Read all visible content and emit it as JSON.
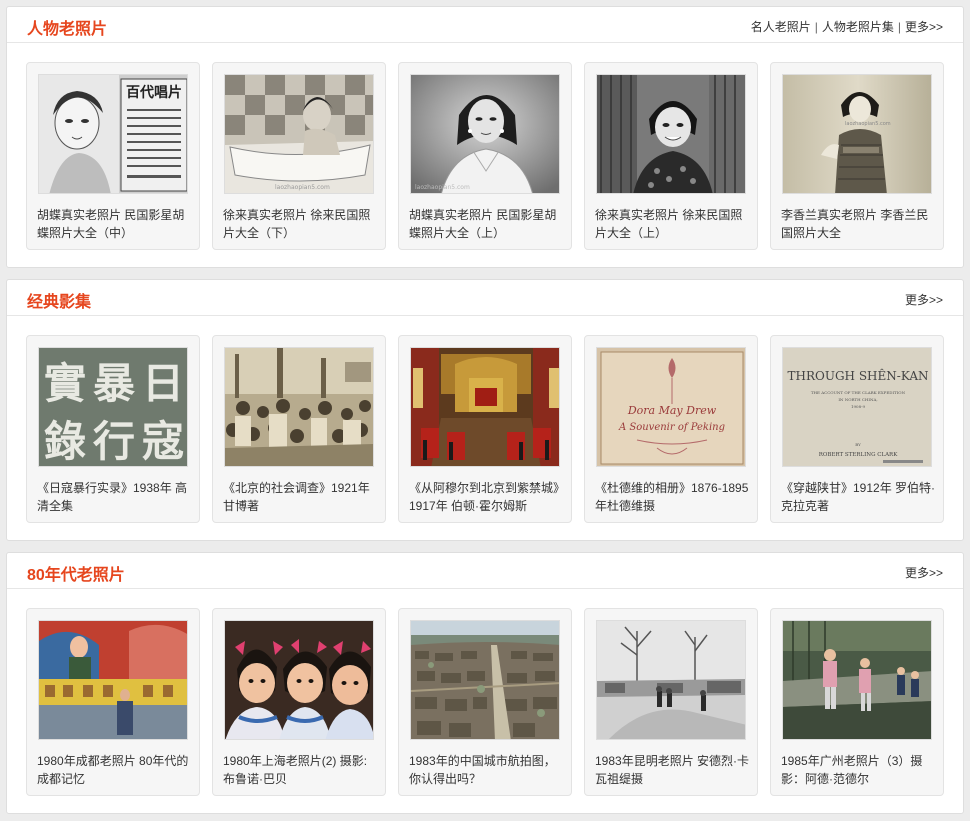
{
  "sections": [
    {
      "title": "人物老照片",
      "links": [
        "名人老照片",
        "人物老照片集",
        "更多>>"
      ],
      "items": [
        {
          "caption": "胡蝶真实老照片 民国影星胡蝶照片大全（中）",
          "poster_text": "百代唱片",
          "watermark": ""
        },
        {
          "caption": "徐来真实老照片 徐来民国照片大全（下）",
          "watermark": "laozhaopian5.com"
        },
        {
          "caption": "胡蝶真实老照片 民国影星胡蝶照片大全（上）",
          "watermark": "laozhaopian5.com"
        },
        {
          "caption": "徐来真实老照片 徐来民国照片大全（上）",
          "watermark": ""
        },
        {
          "caption": "李香兰真实老照片 李香兰民国照片大全",
          "watermark": "laozhaopian5.com"
        }
      ]
    },
    {
      "title": "经典影集",
      "links": [
        "更多>>"
      ],
      "items": [
        {
          "caption": "《日寇暴行实录》1938年 高清全集",
          "cover_chars": [
            "實",
            "暴",
            "日",
            "錄",
            "行",
            "寇"
          ]
        },
        {
          "caption": "《北京的社会调查》1921年 甘博著"
        },
        {
          "caption": "《从阿穆尔到北京到紫禁城》1917年 伯顿·霍尔姆斯"
        },
        {
          "caption": "《杜德维的相册》1876-1895年杜德维摄",
          "cover_line1": "Dora May Drew",
          "cover_line2": "A Souvenir of Peking"
        },
        {
          "caption": "《穿越陕甘》1912年 罗伯特·克拉克著",
          "cover_title": "THROUGH SHÊN-KAN",
          "cover_sub1": "THE ACCOUNT OF THE CLARK EXPEDITION",
          "cover_sub2": "IN NORTH CHINA,",
          "cover_sub3": "1908-9",
          "cover_by": "BY",
          "cover_author": "ROBERT STERLING CLARK"
        }
      ]
    },
    {
      "title": "80年代老照片",
      "links": [
        "更多>>"
      ],
      "items": [
        {
          "caption": "1980年成都老照片 80年代的成都记忆"
        },
        {
          "caption": "1980年上海老照片(2) 摄影:布鲁诺·巴贝"
        },
        {
          "caption": "1983年的中国城市航拍图，你认得出吗？"
        },
        {
          "caption": "1983年昆明老照片 安德烈·卡瓦祖缇摄"
        },
        {
          "caption": "1985年广州老照片（3）摄影：阿德·范德尔"
        }
      ]
    }
  ],
  "colors": {
    "accent": "#e6461e",
    "card_bg": "#f6f6f6",
    "page_bg": "#ececec"
  }
}
